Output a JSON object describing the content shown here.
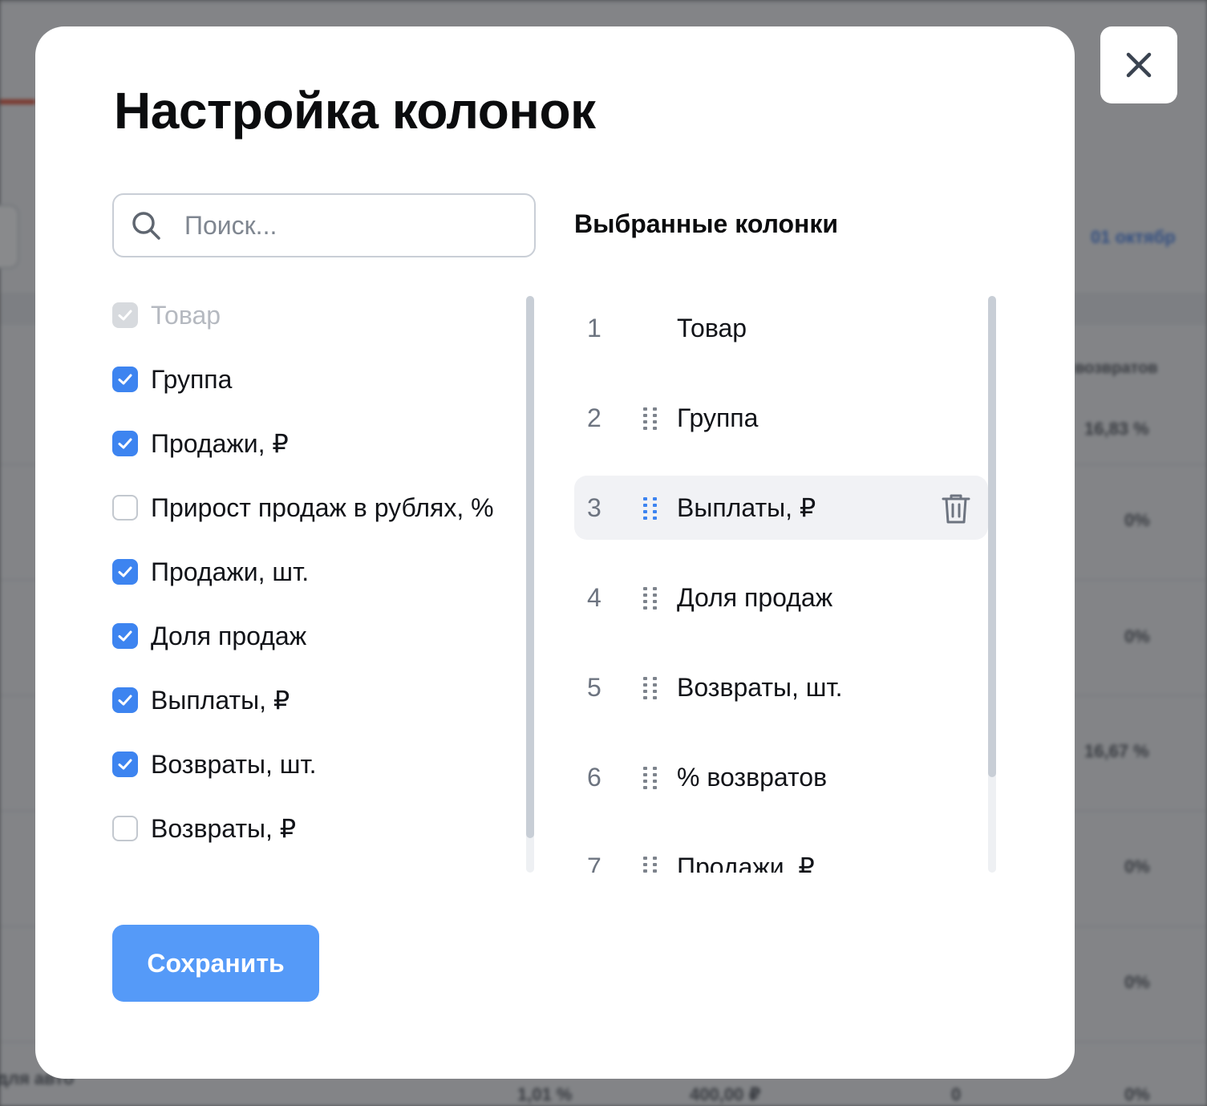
{
  "background": {
    "header_right_date": "01 октябр",
    "col_header": "возвратов",
    "row_values": [
      "16,83 %",
      "0%",
      "0%",
      "16,67 %",
      "0%",
      "0%",
      "0%"
    ],
    "bottom_row": [
      "для авто",
      "1,01 %",
      "400,00 ₽",
      "0",
      "0%"
    ]
  },
  "modal": {
    "title": "Настройка колонок",
    "search_placeholder": "Поиск...",
    "selected_heading": "Выбранные колонки",
    "save_label": "Сохранить",
    "options": [
      {
        "label": "Товар",
        "state": "disabled-checked"
      },
      {
        "label": "Группа",
        "state": "checked"
      },
      {
        "label": "Продажи, ₽",
        "state": "checked"
      },
      {
        "label": "Прирост продаж в рублях, %",
        "state": "unchecked"
      },
      {
        "label": "Продажи, шт.",
        "state": "checked"
      },
      {
        "label": "Доля продаж",
        "state": "checked"
      },
      {
        "label": "Выплаты, ₽",
        "state": "checked"
      },
      {
        "label": "Возвраты, шт.",
        "state": "checked"
      },
      {
        "label": "Возвраты, ₽",
        "state": "unchecked"
      }
    ],
    "selected": [
      {
        "num": "1",
        "label": "Товар",
        "draggable": false
      },
      {
        "num": "2",
        "label": "Группа",
        "draggable": true
      },
      {
        "num": "3",
        "label": "Выплаты, ₽",
        "draggable": true,
        "highlighted": true
      },
      {
        "num": "4",
        "label": "Доля продаж",
        "draggable": true
      },
      {
        "num": "5",
        "label": "Возвраты, шт.",
        "draggable": true
      },
      {
        "num": "6",
        "label": "% возвратов",
        "draggable": true
      },
      {
        "num": "7",
        "label": "Продажи, ₽",
        "draggable": true
      }
    ]
  },
  "colors": {
    "accent": "#3d84f0",
    "save_button": "#559af8",
    "grip_active": "#3d84f0",
    "grip_default": "#7d838c"
  },
  "icons": {
    "close": "close-icon",
    "search": "search-icon",
    "checkbox": "check-icon",
    "drag": "drag-handle-icon",
    "delete": "trash-icon"
  }
}
